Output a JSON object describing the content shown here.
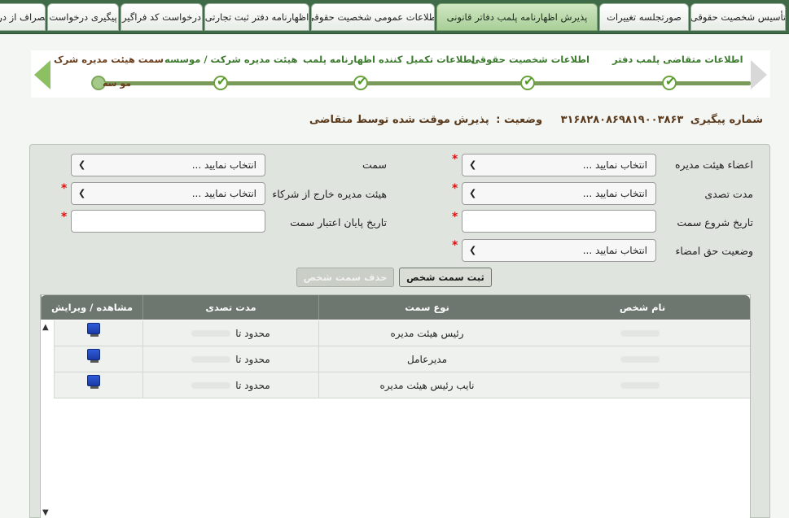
{
  "tabs": [
    {
      "label": "تأسیس شخصیت حقوقی",
      "active": false
    },
    {
      "label": "صورتجلسه تغییرات",
      "active": false
    },
    {
      "label": "پذیرش اظهارنامه پلمب دفاتر قانونی",
      "active": true
    },
    {
      "label": "اطلاعات عمومی شخصیت حقوقی",
      "active": false
    },
    {
      "label": "اظهارنامه دفتر ثبت تجارتی",
      "active": false
    },
    {
      "label": "درخواست کد فراگیر",
      "active": false
    },
    {
      "label": "پیگیری درخواست",
      "active": false
    },
    {
      "label": "انصراف از درخواست",
      "active": false
    }
  ],
  "wizard": {
    "steps": [
      {
        "label": "اطلاعات متقاضی پلمب دفتر",
        "done": true
      },
      {
        "label": "اطلاعات شخصیت حقوقی",
        "done": true
      },
      {
        "label": "اطلاعات تکمیل کننده اظهارنامه پلمب",
        "done": true
      },
      {
        "label": "هیئت مدیره شرکت / موسسه",
        "done": true
      },
      {
        "label": "سمت هیئت مدیره شرک",
        "sub": "مو سه",
        "done": false
      }
    ]
  },
  "status": {
    "tracking_label": "شماره پیگیری",
    "tracking_number": "۳۱۶۸۲۸۰۸۶۹۸۱۹۰۰۳۸۶۳",
    "state_label": "وضعیت :",
    "state_value": "پذیرش موقت شده توسط متقاضی"
  },
  "form": {
    "board_members_label": "اعضاء هیئت مدیره",
    "board_members_value": "انتخاب نمایید ...",
    "position_label": "سمت",
    "position_value": "انتخاب نمایید ...",
    "tenure_label": "مدت تصدی",
    "tenure_value": "انتخاب نمایید ...",
    "outside_board_label": "هیئت مدیره خارج از شرکاء",
    "outside_board_value": "انتخاب نمایید ...",
    "start_date_label": "تاریخ شروع سمت",
    "end_date_label": "تاریخ پایان اعتبار سمت",
    "signature_label": "وضعیت حق امضاء",
    "signature_value": "انتخاب نمایید ...",
    "required_mark": "*",
    "save_button": "ثبت سمت شخص",
    "delete_button": "حذف سمت شخص"
  },
  "grid": {
    "columns": [
      "نام شخص",
      "نوع سمت",
      "مدت تصدی",
      "مشاهده / ویرایش"
    ],
    "rows": [
      {
        "position": "رئیس هیئت مدیره",
        "tenure": "محدود تا"
      },
      {
        "position": "مدیرعامل",
        "tenure": "محدود تا"
      },
      {
        "position": "نایب رئیس هیئت مدیره",
        "tenure": "محدود تا"
      }
    ]
  },
  "icons": {
    "caret": "chevron-down-icon",
    "view": "computer-icon",
    "check": "check-icon"
  },
  "colors": {
    "tabbar": "#3f6b49",
    "active_tab": "#a9cf98",
    "wizard_done": "#3c7a2e",
    "status_text": "#5a3a1c",
    "required": "#dd1111"
  }
}
